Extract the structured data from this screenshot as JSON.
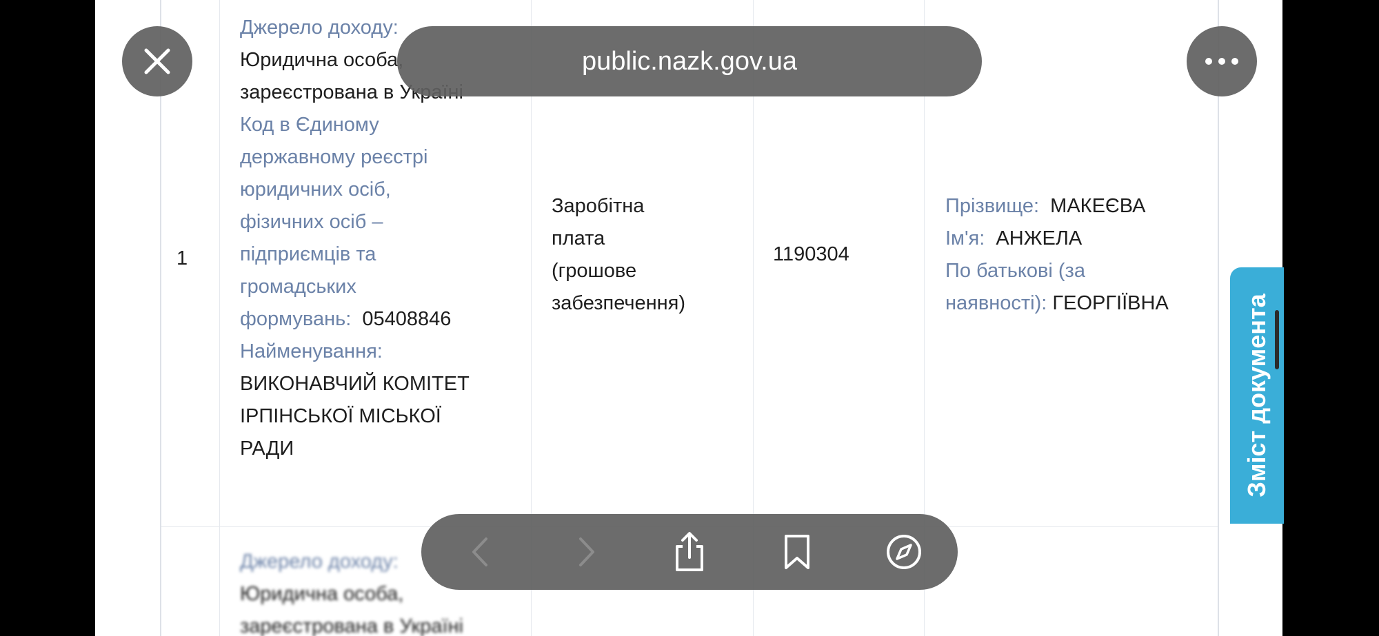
{
  "browser": {
    "url": "public.nazk.gov.ua",
    "close_icon": "close-icon",
    "more_icon": "more-dots-icon",
    "toolbar": {
      "back_icon": "chevron-left-icon",
      "forward_icon": "chevron-right-icon",
      "share_icon": "share-icon",
      "bookmarks_icon": "bookmark-icon",
      "tabs_icon": "compass-icon"
    }
  },
  "side_tab": {
    "label": "Зміст документа"
  },
  "row": {
    "number": "1",
    "source": {
      "source_label": "Джерело доходу:",
      "source_value_line1": "Юридична особа,",
      "source_value_line2": "зареєстрована в Україні",
      "code_label_lines": [
        "Код в Єдиному",
        "державному реєстрі",
        "юридичних осіб,",
        "фізичних осіб –",
        "підприємців та",
        "громадських"
      ],
      "code_label_last": "формувань:",
      "code_value": "05408846",
      "name_label": "Найменування:",
      "name_value_lines": [
        "ВИКОНАВЧИЙ КОМІТЕТ",
        "ІРПІНСЬКОЇ МІСЬКОЇ",
        "РАДИ"
      ]
    },
    "income_type_lines": [
      "Заробітна",
      "плата",
      "(грошове",
      "забезпечення)"
    ],
    "amount": "1190304",
    "person": {
      "surname_label": "Прізвище:",
      "surname_value": "МАКЕЄВА",
      "name_label": "Ім'я:",
      "name_value": "АНЖЕЛА",
      "patronymic_label_line1": "По батькові (за",
      "patronymic_label_line2": "наявності):",
      "patronymic_value": "ГЕОРГІЇВНА"
    }
  },
  "next_row": {
    "source_label": "Джерело доходу:",
    "line1": "Юридична особа,",
    "line2": "зареєстрована в Україні"
  },
  "colors": {
    "label": "#6b82a8",
    "value": "#1e1e1e",
    "side_tab": "#3aaed8",
    "overlay": "#5f5f5f"
  }
}
